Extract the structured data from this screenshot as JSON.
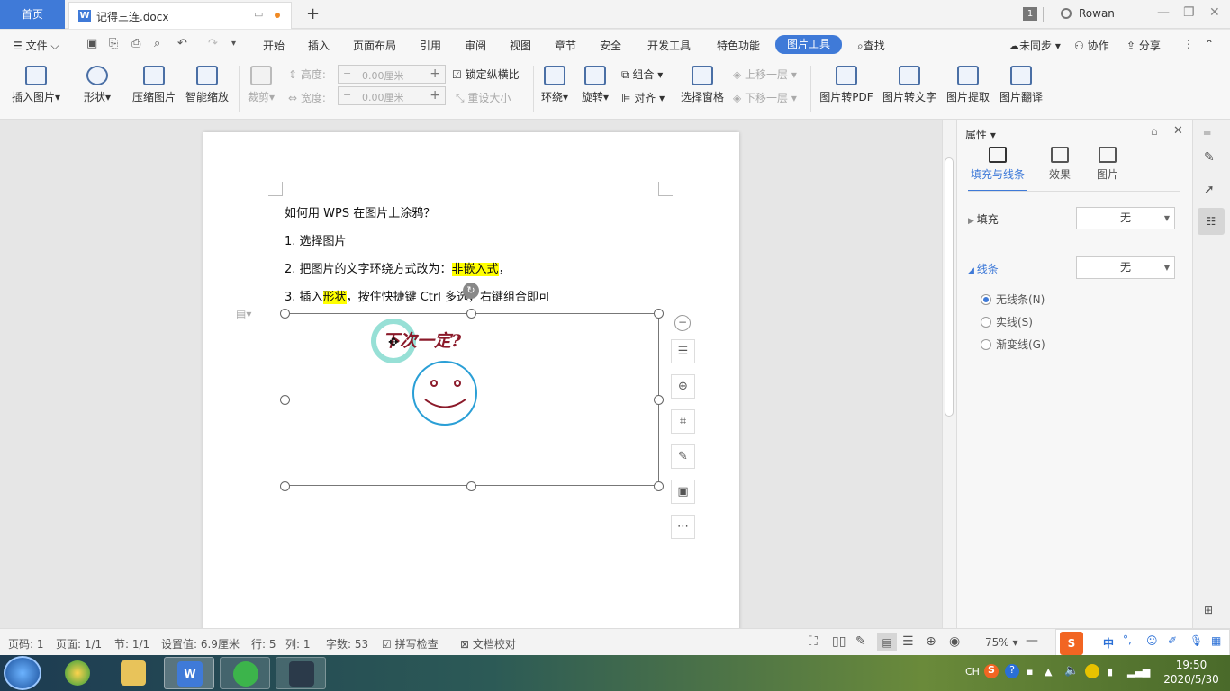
{
  "titlebar": {
    "home_tab": "首页",
    "doc_tab": "记得三连.docx",
    "window_count": "1",
    "user_name": "Rowan"
  },
  "menubar": {
    "file": "文件",
    "items": [
      "开始",
      "插入",
      "页面布局",
      "引用",
      "审阅",
      "视图",
      "章节",
      "安全",
      "开发工具",
      "特色功能"
    ],
    "active_item": "图片工具",
    "search": "查找",
    "sync": "未同步",
    "collab": "协作",
    "share": "分享"
  },
  "toolbar": {
    "insert_picture": "插入图片",
    "shape": "形状",
    "compress": "压缩图片",
    "smart_zoom": "智能缩放",
    "crop": "裁剪",
    "height_label": "高度:",
    "width_label": "宽度:",
    "height_value": "0.00厘米",
    "width_value": "0.00厘米",
    "lock_ratio": "锁定纵横比",
    "reset_size": "重设大小",
    "wrap": "环绕",
    "rotate": "旋转",
    "group": "组合",
    "align": "对齐",
    "selection_pane": "选择窗格",
    "move_up": "上移一层",
    "move_down": "下移一层",
    "to_pdf": "图片转PDF",
    "to_text": "图片转文字",
    "extract": "图片提取",
    "translate": "图片翻译"
  },
  "document": {
    "line1": "如何用 WPS 在图片上涂鸦？",
    "line2": "1. 选择图片",
    "line3_pre": "2. 把图片的文字环绕方式改为：",
    "line3_hl": "非嵌入式",
    "line3_post": "，",
    "line4_pre": "3. 插入",
    "line4_hl": "形状",
    "line4_post": "，按住快捷键 Ctrl 多选，右键组合即可",
    "drawing_text": "下次一定?"
  },
  "properties": {
    "title": "属性",
    "tabs": [
      "填充与线条",
      "效果",
      "图片"
    ],
    "fill_label": "填充",
    "fill_value": "无",
    "line_label": "线条",
    "line_value": "无",
    "radios": [
      "无线条(N)",
      "实线(S)",
      "渐变线(G)"
    ]
  },
  "statusbar": {
    "page_num": "页码: 1",
    "pages": "页面: 1/1",
    "section": "节: 1/1",
    "setting": "设置值: 6.9厘米",
    "row": "行: 5",
    "col": "列: 1",
    "word_count": "字数: 53",
    "spell": "拼写检查",
    "proof": "文档校对",
    "zoom": "75%"
  },
  "taskbar": {
    "time": "19:50",
    "date": "2020/5/30",
    "lang": "CH"
  },
  "colors": {
    "accent": "#3f7ad8",
    "highlight": "#ffff00",
    "drawing_ink": "#8b1a2a",
    "smiley": "#2a9fd6"
  }
}
